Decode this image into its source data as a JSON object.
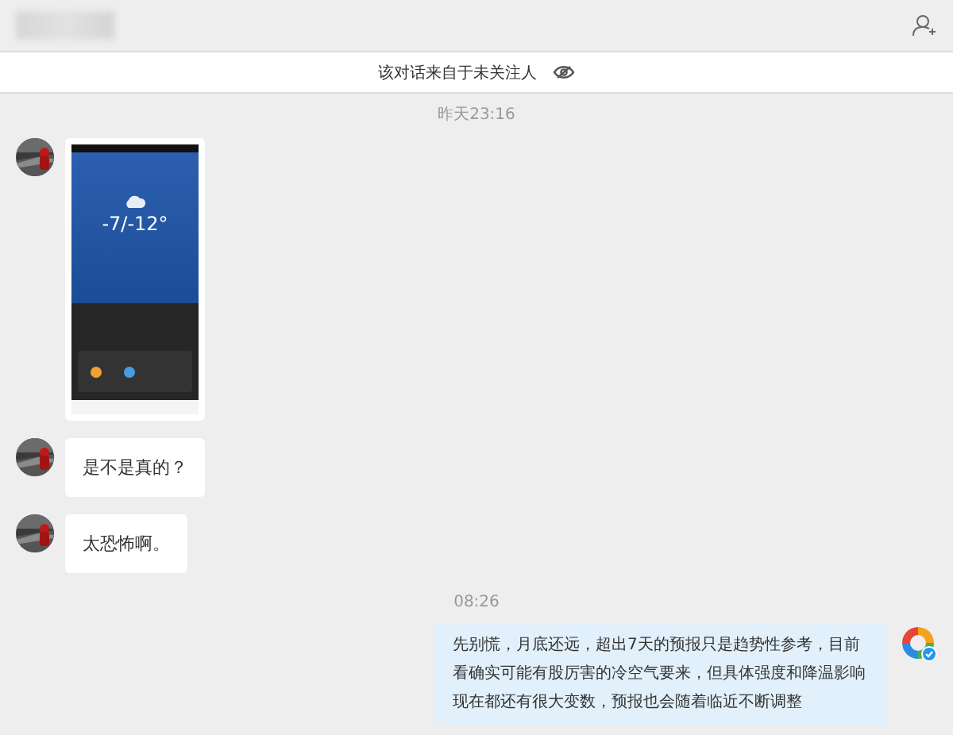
{
  "notice": {
    "text": "该对话来自于未关注人"
  },
  "messages": [
    {
      "kind": "time",
      "text": "昨天23:16"
    },
    {
      "outgoing": false,
      "screenshot": {
        "temperature": "-7/-12°"
      }
    },
    {
      "kind": "text",
      "outgoing": false,
      "text": "是不是真的？"
    },
    {
      "kind": "text",
      "outgoing": false,
      "text": "太恐怖啊。"
    },
    {
      "kind": "time",
      "text": "08:26"
    },
    {
      "kind": "text",
      "outgoing": true,
      "text": "先别慌，月底还远，超出7天的预报只是趋势性参考，目前看确实可能有股厉害的冷空气要来，但具体强度和降温影响现在都还有很大变数，预报也会随着临近不断调整"
    }
  ]
}
